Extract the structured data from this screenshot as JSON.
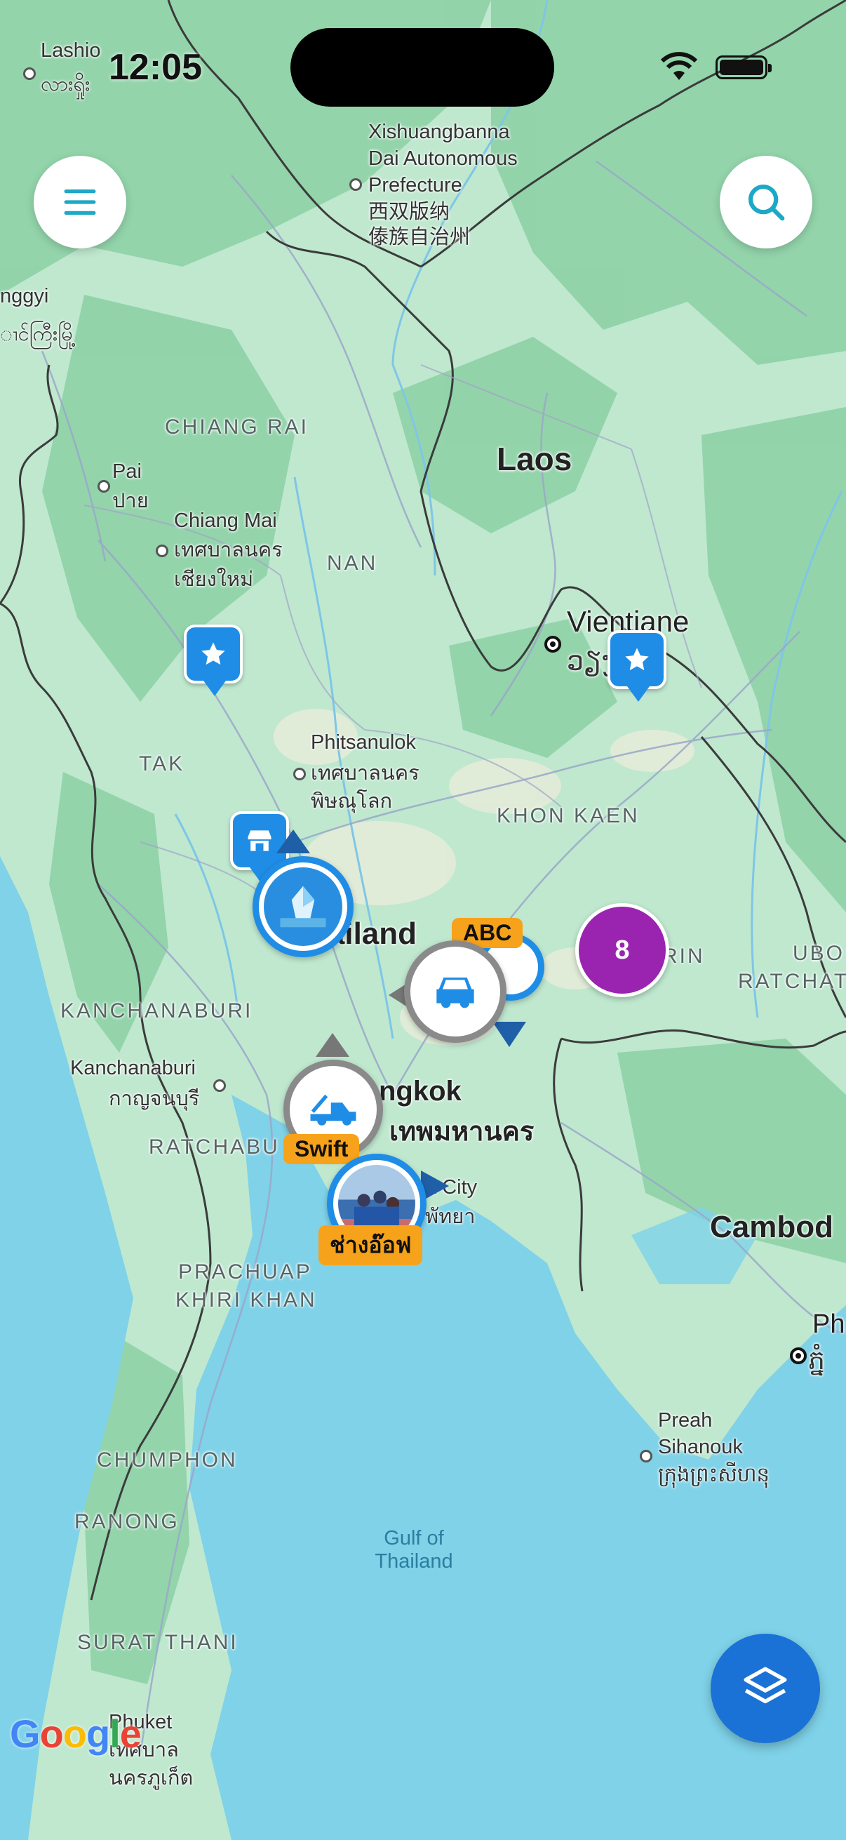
{
  "status_bar": {
    "time": "12:05"
  },
  "map": {
    "labels": {
      "lashio": "Lashio",
      "lashio_local": "လားရှိုး",
      "xishuangbanna_1": "Xishuangbanna",
      "xishuangbanna_2": "Dai Autonomous",
      "xishuangbanna_3": "Prefecture",
      "xishuangbanna_4": "西双版纳",
      "xishuangbanna_5": "傣族自治州",
      "nggyi": "nggyi",
      "nggyi_local": "ၢင်ကြီးမြို့",
      "chiang_rai": "CHIANG RAI",
      "pai": "Pai",
      "pai_local": "ปาย",
      "chiang_mai": "Chiang Mai",
      "chiang_mai_local_1": "เทศบาลนคร",
      "chiang_mai_local_2": "เชียงใหม่",
      "nan": "NAN",
      "laos": "Laos",
      "vientiane": "Vientiane",
      "vientiane_local": "ວຽງ",
      "tak": "TAK",
      "phitsanulok": "Phitsanulok",
      "phitsanulok_local_1": "เทศบาลนคร",
      "phitsanulok_local_2": "พิษณุโลก",
      "khon_kaen": "KHON KAEN",
      "thailand": "hailand",
      "rin": "RIN",
      "ubon_1": "UBO",
      "ubon_2": "RATCHAT",
      "kanchanaburi_region": "KANCHANABURI",
      "kanchanaburi": "Kanchanaburi",
      "kanchanaburi_local": "กาญจนบุรี",
      "bangkok": "ngkok",
      "bangkok_local": "เทพมหานคร",
      "ratchaburi": "RATCHABU",
      "pattaya": "a City",
      "pattaya_local": "พัทยา",
      "cambodia": "Cambod",
      "phnom_penh": "Ph",
      "phnom_penh_local": "ភ្នំ",
      "prachuap_1": "PRACHUAP",
      "prachuap_2": "KHIRI KHAN",
      "preah_1": "Preah",
      "preah_2": "Sihanouk",
      "preah_local": "ក្រុងព្រះសីហនុ",
      "chumphon": "CHUMPHON",
      "ranong": "RANONG",
      "gulf_1": "Gulf of",
      "gulf_2": "Thailand",
      "surat_thani": "SURAT THANI",
      "phuket": "Phuket",
      "phuket_local_1": "เทศบาล",
      "phuket_local_2": "นครภูเก็ต"
    }
  },
  "markers": {
    "tag_abc": "ABC",
    "tag_swift": "Swift",
    "tag_chang": "ช่างอ๊อฟ",
    "cluster_count": "8"
  },
  "google_logo": {
    "g1": "G",
    "o1": "o",
    "o2": "o",
    "g2": "g",
    "l": "l",
    "e": "e"
  },
  "colors": {
    "accent": "#1f8de6",
    "cluster": "#9a24b0",
    "tag": "#f7a21b",
    "fab": "#1a72d6",
    "icon_teal": "#1da8c6"
  },
  "icons": [
    "menu-icon",
    "search-icon",
    "layers-icon",
    "star-icon",
    "shop-icon",
    "ice-icon",
    "car-icon",
    "tow-truck-icon"
  ]
}
